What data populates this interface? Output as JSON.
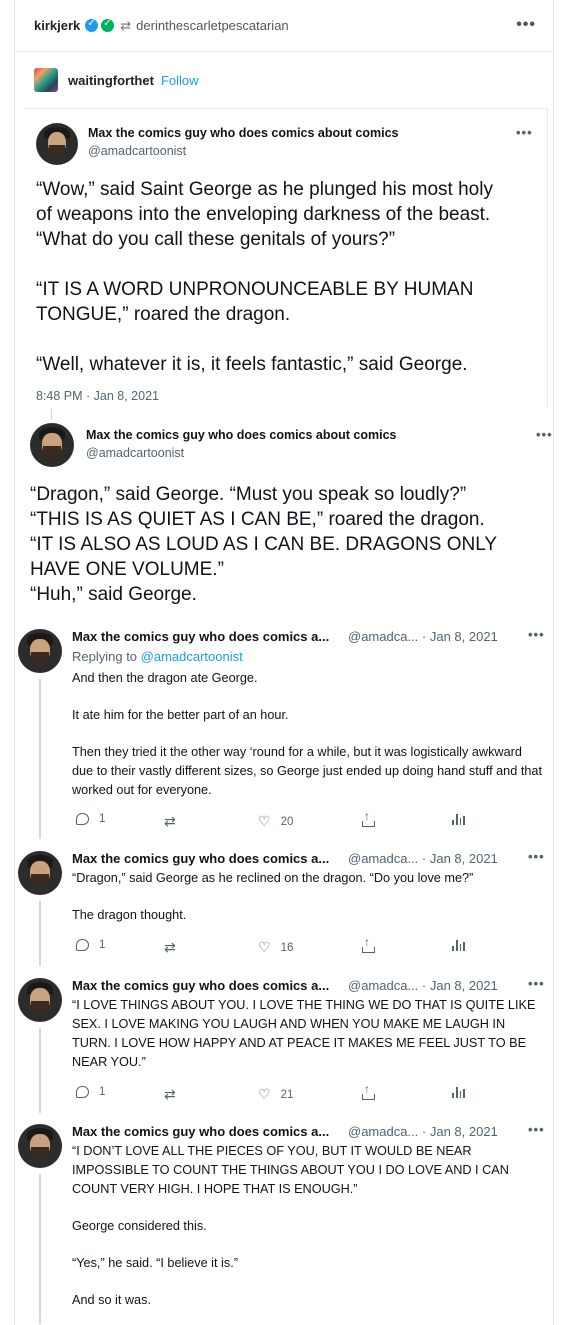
{
  "header": {
    "reblogger": "kirkjerk",
    "reblogged_from": "derinthescarletpescatarian",
    "more": "•••"
  },
  "source": {
    "blog": "waitingforthet",
    "follow": "Follow"
  },
  "embed1": {
    "name": "Max the comics guy who does comics about comics",
    "handle": "@amadcartoonist",
    "more": "•••",
    "text": "“Wow,” said Saint George as he plunged his most holy\nof weapons into the enveloping darkness of the beast.\n“What do you call these genitals of yours?”\n\n“IT IS A WORD UNPRONOUNCEABLE BY HUMAN\nTONGUE,” roared the dragon.\n\n“Well, whatever it is, it feels fantastic,” said George.",
    "time": "8:48 PM · Jan 8, 2021"
  },
  "embed2": {
    "name": "Max the comics guy who does comics about comics",
    "handle": "@amadcartoonist",
    "more": "•••",
    "text": "“Dragon,” said George. “Must you speak so loudly?”\n“THIS IS AS QUIET AS I CAN BE,” roared the dragon.\n“IT IS ALSO AS LOUD AS I CAN BE. DRAGONS ONLY\nHAVE ONE VOLUME.”\n“Huh,” said George."
  },
  "replies": [
    {
      "name": "Max the comics guy who does comics a...",
      "handle": "@amadca... · Jan 8, 2021",
      "more": "•••",
      "replying_prefix": "Replying to ",
      "replying_to": "@amadcartoonist",
      "paragraphs": [
        "And then the dragon ate George.",
        "It ate him for the better part of an hour.",
        "Then they tried it the other way ‘round for a while, but it was logistically awkward due to their vastly different sizes, so George just ended up doing hand stuff and that worked out for everyone."
      ],
      "replies_count": "1",
      "likes": "20"
    },
    {
      "name": "Max the comics guy who does comics a...",
      "handle": "@amadca... · Jan 8, 2021",
      "more": "•••",
      "paragraphs": [
        "“Dragon,” said George as he reclined on the dragon. “Do you love me?”",
        "The dragon thought."
      ],
      "replies_count": "1",
      "likes": "16"
    },
    {
      "name": "Max the comics guy who does comics a...",
      "handle": "@amadca... · Jan 8, 2021",
      "more": "•••",
      "paragraphs": [
        "“I LOVE THINGS ABOUT YOU. I LOVE THE THING WE DO THAT IS QUITE LIKE SEX. I LOVE MAKING YOU LAUGH AND WHEN YOU MAKE ME LAUGH IN TURN. I LOVE HOW HAPPY AND AT PEACE IT MAKES ME FEEL JUST TO BE NEAR YOU.”"
      ],
      "replies_count": "1",
      "likes": "21"
    },
    {
      "name": "Max the comics guy who does comics a...",
      "handle": "@amadca... · Jan 8, 2021",
      "more": "•••",
      "paragraphs": [
        "“I DON’T LOVE ALL THE PIECES OF YOU, BUT IT WOULD BE NEAR IMPOSSIBLE TO COUNT THE THINGS ABOUT YOU I DO LOVE AND I CAN COUNT VERY HIGH. I HOPE THAT IS ENOUGH.”",
        "George considered this.",
        "“Yes,” he said. “I believe it is.”",
        "And so it was."
      ]
    }
  ]
}
